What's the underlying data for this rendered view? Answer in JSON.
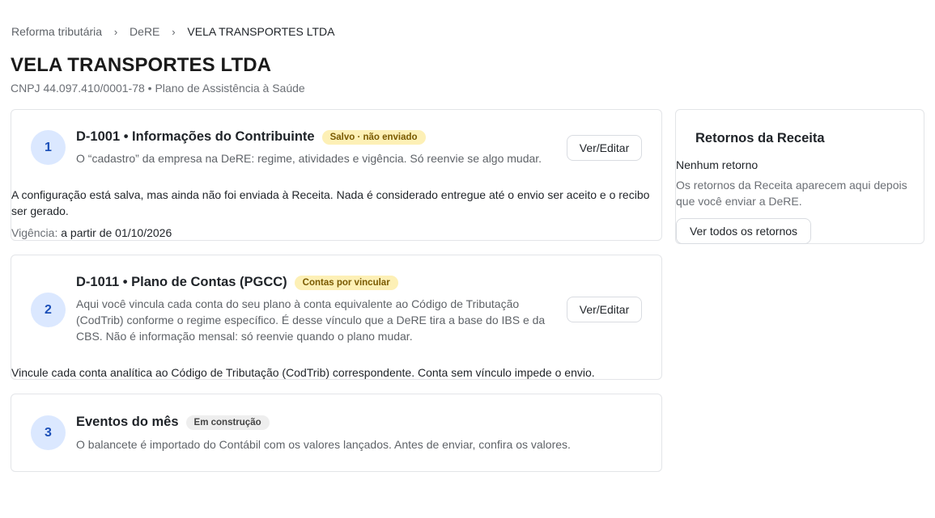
{
  "breadcrumb": {
    "items": [
      "Reforma tributária",
      "DeRE",
      "VELA TRANSPORTES LTDA"
    ],
    "separator": "›"
  },
  "header": {
    "title": "VELA TRANSPORTES LTDA",
    "subtitle": "CNPJ 44.097.410/0001-78 • Plano de Assistência à Saúde"
  },
  "steps": [
    {
      "number": "1",
      "title": "D-1001 • Informações do Contribuinte",
      "badge": "Salvo · não enviado",
      "description": "O “cadastro” da empresa na DeRE: regime, atividades e vigência. Só reenvie se algo mudar.",
      "button_label": "Ver/Editar",
      "note": "A configuração está salva, mas ainda não foi enviada à Receita. Nada é considerado entregue até o envio ser aceito e o recibo ser gerado.",
      "vigencia_label": "Vigência:",
      "vigencia_value": "a partir de 01/10/2026"
    },
    {
      "number": "2",
      "title": "D-1011 • Plano de Contas (PGCC)",
      "badge": "Contas por vincular",
      "description": "Aqui você vincula cada conta do seu plano à conta equivalente ao Código de Tributação (CodTrib) conforme o regime específico. É desse vínculo que a DeRE tira a base do IBS e da CBS. Não é informação mensal: só reenvie quando o plano mudar.",
      "button_label": "Ver/Editar",
      "note": "Vincule cada conta analítica ao Código de Tributação (CodTrib) correspondente. Conta sem vínculo impede o envio."
    },
    {
      "number": "3",
      "title": "Eventos do mês",
      "badge": "Em construção",
      "description": "O balancete é importado do Contábil com os valores lançados. Antes de enviar, confira os valores."
    }
  ],
  "sidebar": {
    "title": "Retornos da Receita",
    "empty_title": "Nenhum retorno",
    "empty_desc": "Os retornos da Receita aparecem aqui depois que você enviar a DeRE.",
    "button_label": "Ver todos os retornos"
  },
  "colors": {
    "step_circle_bg": "#dbe8ff",
    "step_circle_text": "#1b4fb8",
    "badge_warning_bg": "#fdf0b6",
    "badge_neutral_bg": "#eeeeee"
  }
}
